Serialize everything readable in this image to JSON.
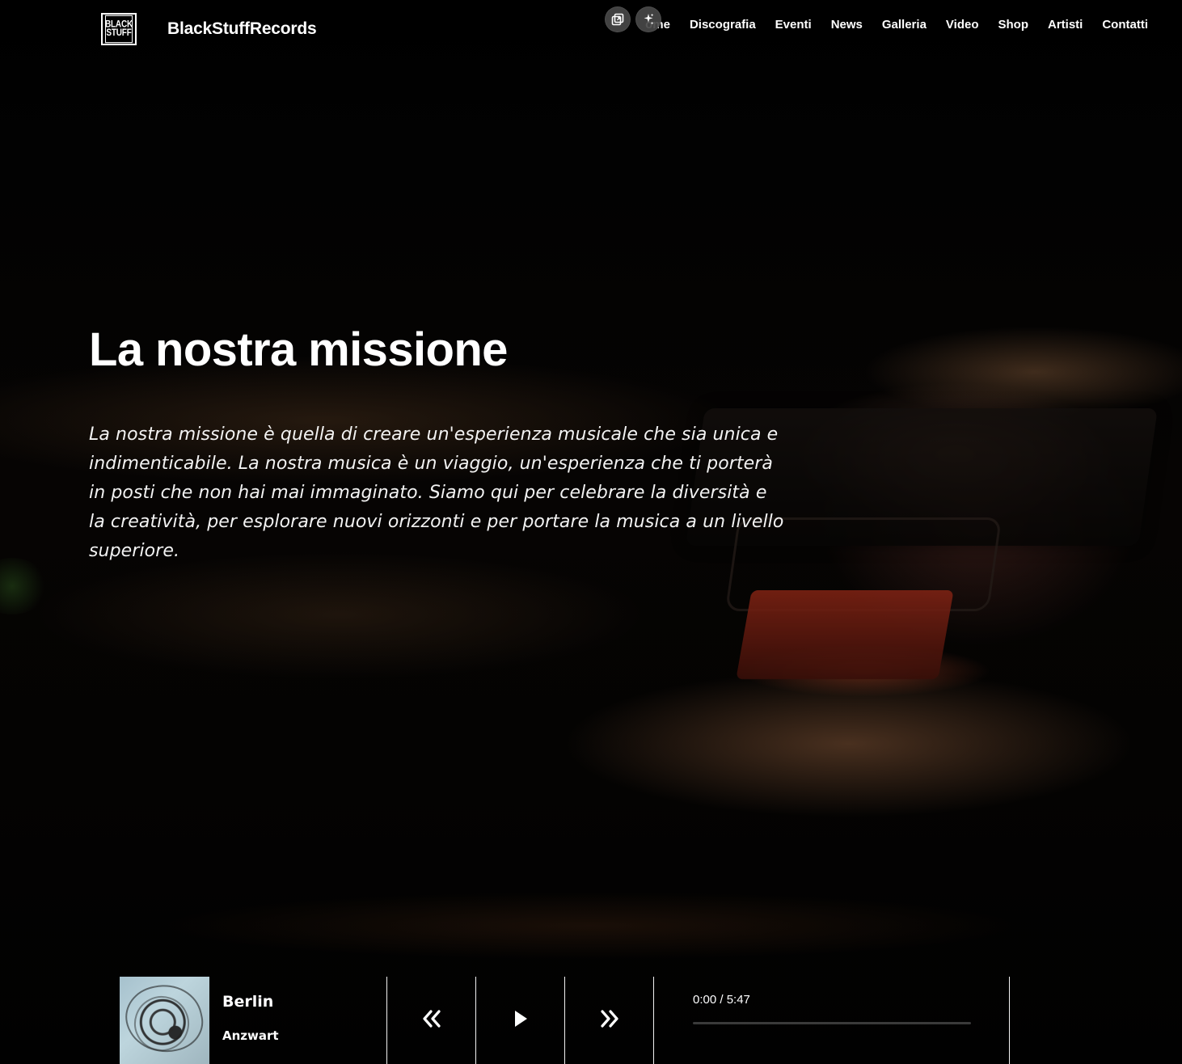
{
  "header": {
    "logo_text_line1": "BLACK",
    "logo_text_line2": "STUFF",
    "brand": "BlackStuffRecords",
    "nav": [
      "ome",
      "Discografia",
      "Eventi",
      "News",
      "Galleria",
      "Video",
      "Shop",
      "Artisti",
      "Contatti"
    ]
  },
  "floating_actions": {
    "left_icon": "copy-window-icon",
    "right_icon": "sparkles-icon"
  },
  "hero": {
    "title": "La nostra missione",
    "body": "La nostra missione è quella di creare un'esperienza musicale che sia unica e indimenticabile. La nostra musica è un viaggio, un'esperienza che ti porterà in posti che non hai mai immaginato. Siamo qui per celebrare la diversità e la creatività, per esplorare nuovi orizzonti e per portare la musica a un livello superiore."
  },
  "player": {
    "track_title": "Berlin",
    "artist": "Anzwart",
    "time": "0:00 / 5:47",
    "progress": 0,
    "controls": {
      "previous_icon": "double-chevron-left-icon",
      "play_icon": "play-icon",
      "next_icon": "double-chevron-right-icon"
    }
  },
  "colors": {
    "background": "#000000",
    "text": "#ffffff",
    "player_track": "#3a3a3a",
    "fab_bg": "#484848"
  }
}
